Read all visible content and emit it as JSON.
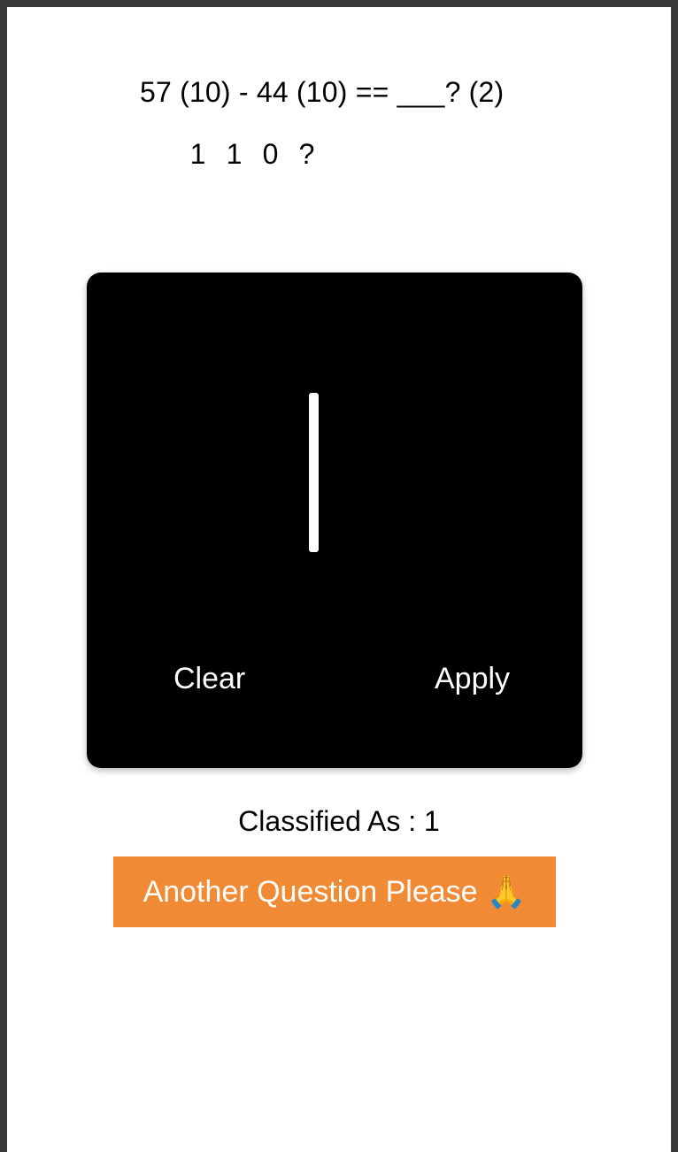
{
  "question": {
    "text": "57 (10) - 44 (10) == ___? (2)",
    "answer_digits": [
      "1",
      "1",
      "0",
      "?"
    ]
  },
  "canvas": {
    "clear_label": "Clear",
    "apply_label": "Apply"
  },
  "result": {
    "text": "Classified As : 1"
  },
  "next": {
    "label": "Another Question Please",
    "icon": "🙏"
  },
  "colors": {
    "button_accent": "#f08a35",
    "canvas_bg": "#000000"
  }
}
